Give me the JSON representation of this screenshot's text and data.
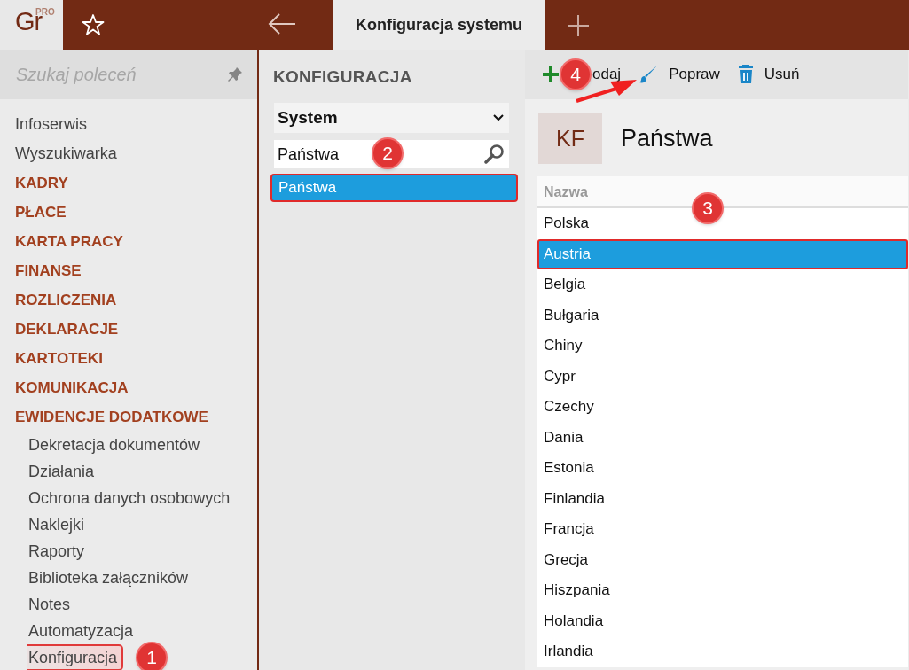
{
  "app": {
    "logo": "Gr",
    "edition": "PRO"
  },
  "tabs": [
    {
      "label": "Konfiguracja systemu",
      "selected": true
    }
  ],
  "sidebar": {
    "search_placeholder": "Szukaj poleceń",
    "items": [
      {
        "label": "Infoserwis",
        "kind": "link"
      },
      {
        "label": "Wyszukiwarka",
        "kind": "link"
      },
      {
        "label": "KADRY",
        "kind": "section"
      },
      {
        "label": "PŁACE",
        "kind": "section"
      },
      {
        "label": "KARTA PRACY",
        "kind": "section"
      },
      {
        "label": "FINANSE",
        "kind": "section"
      },
      {
        "label": "ROZLICZENIA",
        "kind": "section"
      },
      {
        "label": "DEKLARACJE",
        "kind": "section"
      },
      {
        "label": "KARTOTEKI",
        "kind": "section"
      },
      {
        "label": "KOMUNIKACJA",
        "kind": "section"
      },
      {
        "label": "EWIDENCJE DODATKOWE",
        "kind": "section",
        "children": [
          {
            "label": "Dekretacja dokumentów",
            "selected": false
          },
          {
            "label": "Działania",
            "selected": false
          },
          {
            "label": "Ochrona danych osobowych",
            "selected": false
          },
          {
            "label": "Naklejki",
            "selected": false
          },
          {
            "label": "Raporty",
            "selected": false
          },
          {
            "label": "Biblioteka załączników",
            "selected": false
          },
          {
            "label": "Notes",
            "selected": false
          },
          {
            "label": "Automatyzacja",
            "selected": false
          },
          {
            "label": "Konfiguracja",
            "selected": true,
            "callout": "1"
          }
        ]
      }
    ]
  },
  "config": {
    "title": "KONFIGURACJA",
    "group": "System",
    "search_value": "Państwa",
    "search_callout": "2",
    "results": [
      {
        "label": "Państwa",
        "selected": true
      }
    ]
  },
  "toolbar": [
    {
      "label": "odaj",
      "kind": "add",
      "callout": "4"
    },
    {
      "label": "Popraw",
      "kind": "edit"
    },
    {
      "label": "Usuń",
      "kind": "delete"
    }
  ],
  "view": {
    "badge": "KF",
    "title": "Państwa",
    "column": "Nazwa",
    "callout": "3",
    "rows": [
      {
        "name": "Polska",
        "selected": false
      },
      {
        "name": "Austria",
        "selected": true
      },
      {
        "name": "Belgia",
        "selected": false
      },
      {
        "name": "Bułgaria",
        "selected": false
      },
      {
        "name": "Chiny",
        "selected": false
      },
      {
        "name": "Cypr",
        "selected": false
      },
      {
        "name": "Czechy",
        "selected": false
      },
      {
        "name": "Dania",
        "selected": false
      },
      {
        "name": "Estonia",
        "selected": false
      },
      {
        "name": "Finlandia",
        "selected": false
      },
      {
        "name": "Francja",
        "selected": false
      },
      {
        "name": "Grecja",
        "selected": false
      },
      {
        "name": "Hiszpania",
        "selected": false
      },
      {
        "name": "Holandia",
        "selected": false
      },
      {
        "name": "Irlandia",
        "selected": false
      }
    ]
  }
}
